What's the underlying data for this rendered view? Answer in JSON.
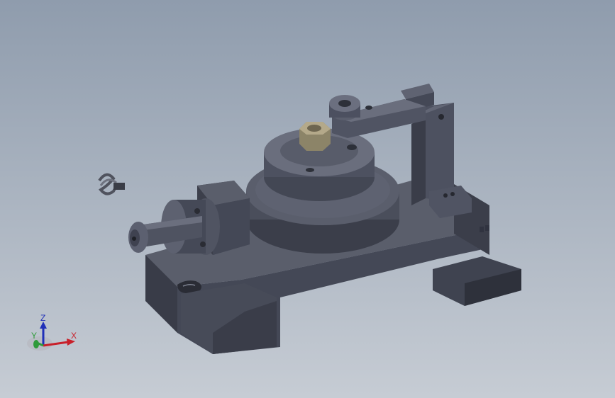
{
  "viewport": {
    "background_top": "#8f9cad",
    "background_bottom": "#c6ccd4",
    "model_color": "#4e5260",
    "model_dark": "#363944",
    "model_light": "#707585",
    "nut_color": "#b4a98a"
  },
  "triad": {
    "x_label": "X",
    "y_label": "Y",
    "z_label": "Z",
    "x_color": "#c8202a",
    "y_color": "#2f9a3a",
    "z_color": "#2030b8"
  }
}
